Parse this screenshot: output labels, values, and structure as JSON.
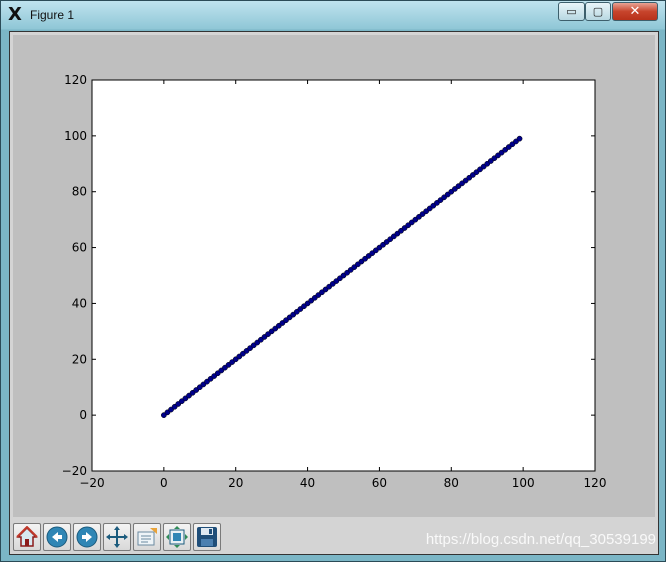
{
  "window": {
    "title": "Figure 1",
    "minimize_glyph": "▭",
    "maximize_glyph": "▢",
    "close_glyph": "✕"
  },
  "toolbar": {
    "icons": [
      "home-icon",
      "back-arrow-icon",
      "forward-arrow-icon",
      "pan-move-icon",
      "zoom-rect-icon",
      "subplots-config-icon",
      "save-floppy-icon"
    ]
  },
  "watermark": "https://blog.csdn.net/qq_30539199",
  "colors": {
    "figure_bg": "#bfbfbf",
    "axes_bg": "#ffffff",
    "series": "#00008b",
    "toolbar_bg": "#d4d4d4"
  },
  "chart_data": {
    "type": "scatter",
    "title": "",
    "xlabel": "",
    "ylabel": "",
    "xlim": [
      -20,
      120
    ],
    "ylim": [
      -20,
      120
    ],
    "xticks": [
      "−20",
      "0",
      "20",
      "40",
      "60",
      "80",
      "100",
      "120"
    ],
    "yticks": [
      "−20",
      "0",
      "20",
      "40",
      "60",
      "80",
      "100",
      "120"
    ],
    "grid": false,
    "series": [
      {
        "x_start": 0,
        "x_end": 99,
        "x_step": 1,
        "y_equals_x": true,
        "marker": "circle",
        "connected_line": true
      }
    ]
  }
}
